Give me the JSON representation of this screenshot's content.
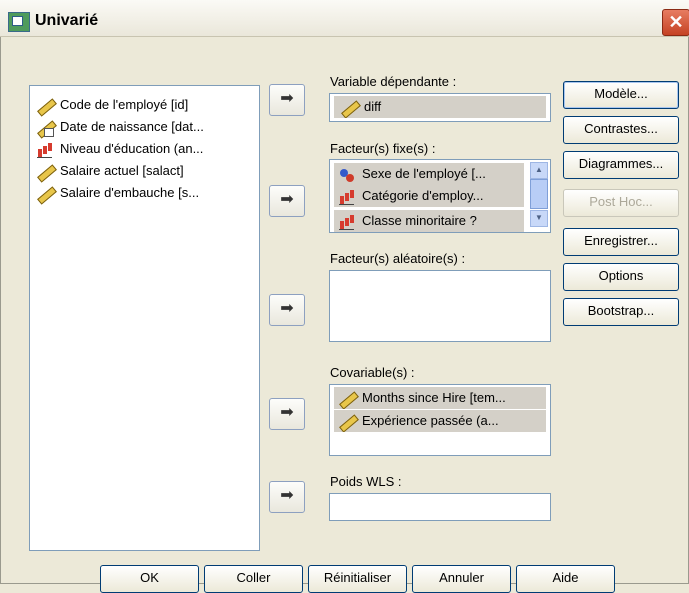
{
  "window": {
    "title": "Univarié",
    "close_glyph": "✕"
  },
  "source_list": {
    "items": [
      {
        "label": "Code de l'employé [id]",
        "icon": "ruler-icon"
      },
      {
        "label": "Date de naissance [dat...",
        "icon": "date-ruler-icon"
      },
      {
        "label": "Niveau d'éducation (an...",
        "icon": "ordinal-bars-icon"
      },
      {
        "label": "Salaire actuel [salact]",
        "icon": "ruler-icon"
      },
      {
        "label": "Salaire d'embauche [s...",
        "icon": "ruler-icon"
      }
    ]
  },
  "arrow_glyph": "➡",
  "dependent": {
    "label": "Variable dépendante :",
    "value": "diff"
  },
  "fixed_factors": {
    "label": "Facteur(s) fixe(s) :",
    "items": [
      "Sexe de l'employé [...",
      "Catégorie d'employ...",
      "Classe minoritaire ?"
    ]
  },
  "random_factors": {
    "label": "Facteur(s) aléatoire(s) :"
  },
  "covariates": {
    "label": "Covariable(s) :",
    "items": [
      "Months since Hire [tem...",
      "Expérience passée (a..."
    ]
  },
  "wls": {
    "label": "Poids WLS :",
    "value": ""
  },
  "side_buttons": {
    "model": "Modèle...",
    "contrasts": "Contrastes...",
    "plots": "Diagrammes...",
    "posthoc": "Post Hoc...",
    "save": "Enregistrer...",
    "options": "Options",
    "bootstrap": "Bootstrap..."
  },
  "bottom_buttons": {
    "ok": "OK",
    "paste": "Coller",
    "reset": "Réinitialiser",
    "cancel": "Annuler",
    "help": "Aide"
  }
}
